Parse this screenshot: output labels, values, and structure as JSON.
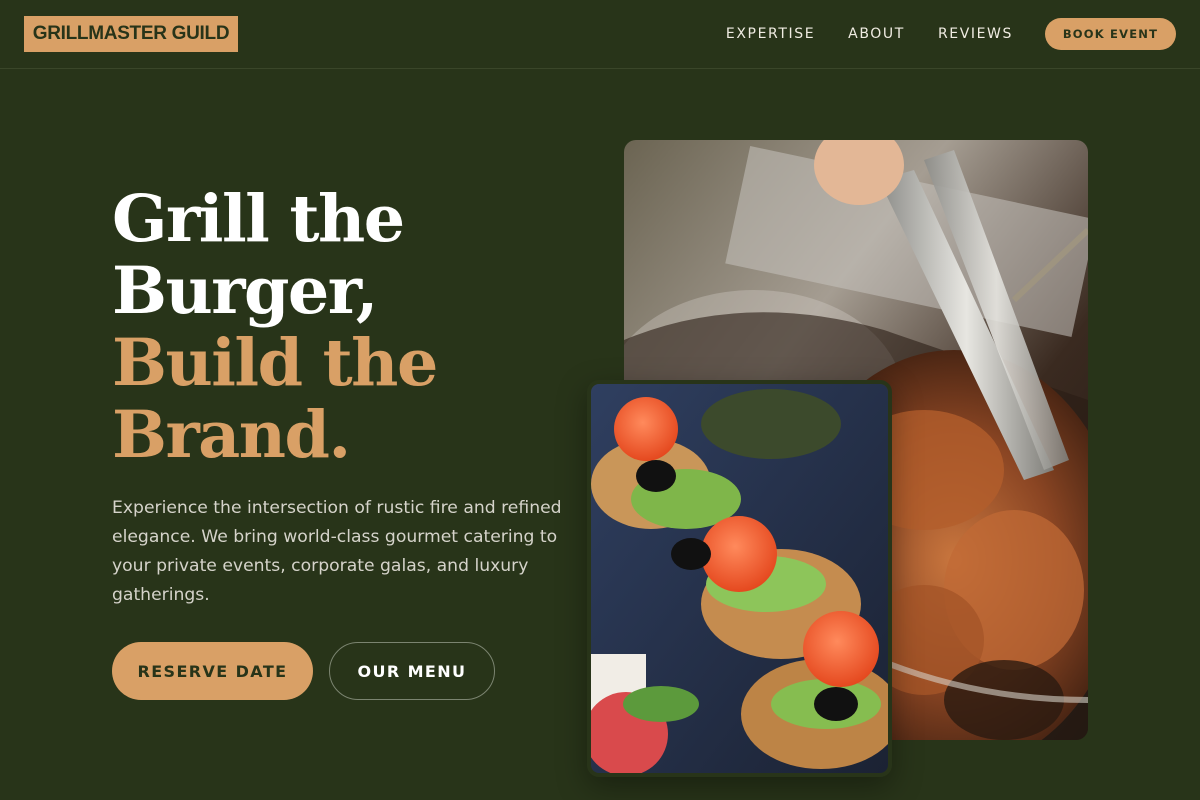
{
  "header": {
    "logo": "GRILLMASTER GUILD",
    "nav": [
      "EXPERTISE",
      "ABOUT",
      "REVIEWS"
    ],
    "cta": "BOOK EVENT"
  },
  "hero": {
    "headline_lines": [
      "Grill the",
      "Burger,"
    ],
    "headline_accent_lines": [
      "Build the",
      "Brand."
    ],
    "description": "Experience the intersection of rustic fire and refined elegance. We bring world-class gourmet catering to your private events, corporate galas, and luxury gatherings.",
    "primary_button": "RESERVE DATE",
    "secondary_button": "OUR MENU"
  },
  "images": {
    "main": "grilled-meat-with-tongs-photo",
    "secondary": "salmon-canapes-photo"
  },
  "colors": {
    "background": "#283419",
    "accent": "#d9a066",
    "text": "#ffffff",
    "muted_text": "#d5d3ca"
  }
}
